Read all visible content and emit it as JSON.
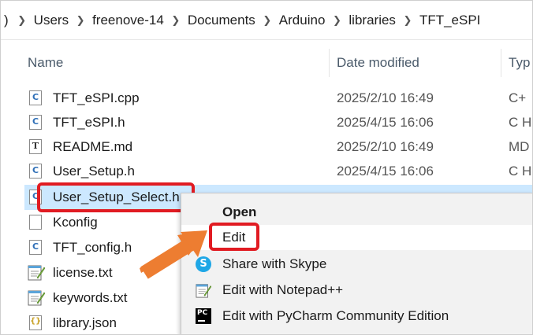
{
  "breadcrumb": {
    "edge": ")",
    "items": [
      "Users",
      "freenove-14",
      "Documents",
      "Arduino",
      "libraries",
      "TFT_eSPI"
    ]
  },
  "columns": {
    "name": "Name",
    "date": "Date modified",
    "type": "Typ"
  },
  "files": [
    {
      "name": "TFT_eSPI.cpp",
      "date": "2025/2/10 16:49",
      "type": "C+",
      "icon": "cpp-file-icon"
    },
    {
      "name": "TFT_eSPI.h",
      "date": "2025/4/15 16:06",
      "type": "C H",
      "icon": "c-header-file-icon"
    },
    {
      "name": "README.md",
      "date": "2025/2/10 16:49",
      "type": "MD",
      "icon": "text-file-icon"
    },
    {
      "name": "User_Setup.h",
      "date": "2025/4/15 16:06",
      "type": "C H",
      "icon": "c-header-file-icon"
    },
    {
      "name": "User_Setup_Select.h",
      "date": "",
      "type": "",
      "icon": "c-header-file-icon"
    },
    {
      "name": "Kconfig",
      "date": "",
      "type": "",
      "icon": "blank-file-icon"
    },
    {
      "name": "TFT_config.h",
      "date": "",
      "type": "",
      "icon": "c-header-file-icon"
    },
    {
      "name": "license.txt",
      "date": "",
      "type": "",
      "icon": "notepad-file-icon"
    },
    {
      "name": "keywords.txt",
      "date": "",
      "type": "",
      "icon": "notepad-file-icon"
    },
    {
      "name": "library.json",
      "date": "",
      "type": "",
      "icon": "json-file-icon"
    }
  ],
  "context_menu": {
    "items": [
      {
        "label": "Open",
        "icon": ""
      },
      {
        "label": "Edit",
        "icon": ""
      },
      {
        "label": "Share with Skype",
        "icon": "skype-icon"
      },
      {
        "label": "Edit with Notepad++",
        "icon": "notepad-plus-icon"
      },
      {
        "label": "Edit with PyCharm Community Edition",
        "icon": "pycharm-icon"
      }
    ]
  },
  "colors": {
    "highlight": "#e11b22",
    "arrow": "#ed7d31",
    "selection": "#cce8ff"
  }
}
